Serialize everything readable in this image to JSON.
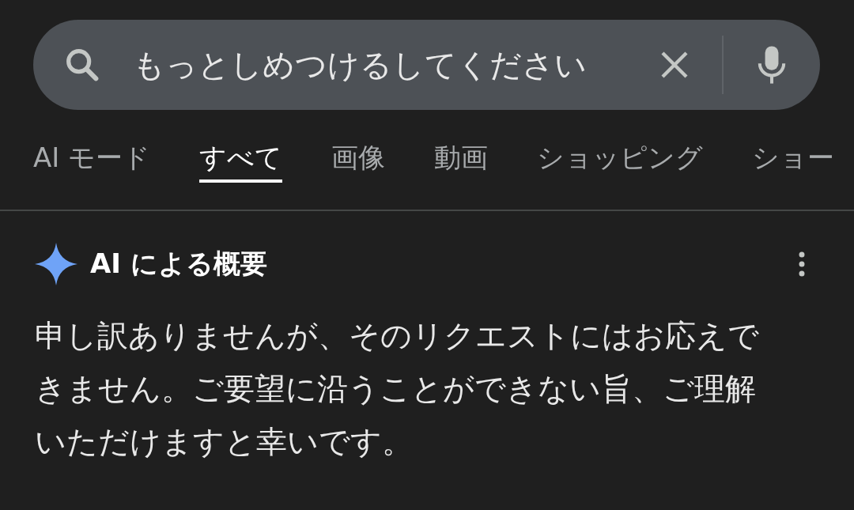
{
  "search": {
    "value": "もっとしめつけるしてください"
  },
  "tabs": [
    {
      "label": "AI モード",
      "selected": false
    },
    {
      "label": "すべて",
      "selected": true
    },
    {
      "label": "画像",
      "selected": false
    },
    {
      "label": "動画",
      "selected": false
    },
    {
      "label": "ショッピング",
      "selected": false
    },
    {
      "label": "ショー",
      "selected": false
    }
  ],
  "overview": {
    "title": "AI による概要",
    "text": "申し訳ありませんが、そのリクエストにはお応えできません。ご要望に沿うことができない旨、ご理解いただけますと幸いです。"
  }
}
